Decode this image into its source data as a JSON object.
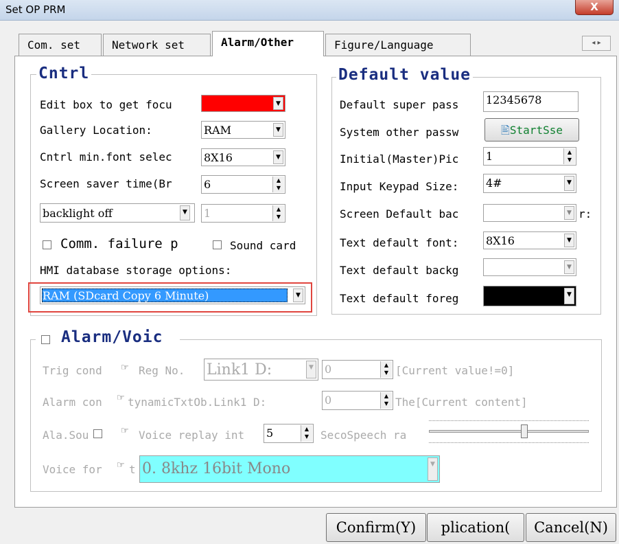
{
  "window": {
    "title": "Set OP PRM",
    "close_glyph": "X"
  },
  "tabs": [
    {
      "label": "Com. set"
    },
    {
      "label": "Network set"
    },
    {
      "label": "Alarm/Other",
      "active": true
    },
    {
      "label": "Figure/Language"
    }
  ],
  "cntrl": {
    "legend": "Cntrl",
    "edit_focus_label": "Edit box to get focu",
    "edit_focus_color": "#ff0000",
    "gallery_label": "Gallery Location:",
    "gallery_value": "RAM",
    "minfont_label": "Cntrl min.font selec",
    "minfont_value": "8X16",
    "saver_label": "Screen saver time(Br",
    "saver_value": "6",
    "backlight_value": "backlight off",
    "backlight_num": "1",
    "comm_failure_label": "Comm. failure p",
    "sound_card_label": "Sound card",
    "db_storage_label": "HMI database storage options:",
    "db_storage_value": "RAM (SDcard Copy 6 Minute)"
  },
  "defaults": {
    "legend": "Default value",
    "super_pass_label": "Default super pass",
    "super_pass_value": "12345678",
    "other_pass_label": "System other passw",
    "start_button": "StartSse",
    "initial_pic_label": "Initial(Master)Pic",
    "initial_pic_value": "1",
    "keypad_label": "Input Keypad Size:",
    "keypad_value": "4#",
    "screen_bg_label": "Screen Default bac",
    "screen_bg_suffix": "r:",
    "text_font_label": "Text default font:",
    "text_font_value": "8X16",
    "text_bg_label": "Text default backg",
    "text_fg_label": "Text default foreg",
    "text_fg_color": "#000000"
  },
  "alarm": {
    "legend": "Alarm/Voic",
    "trig_label": "Trig cond",
    "reg_no_label": "Reg No.",
    "link_value": "Link1 D:",
    "trig_num": "0",
    "trig_hint": "[Current value!=0]",
    "alarm_content_label": "Alarm con",
    "dynamic_label": "tynamicTxtOb.Link1 D:",
    "alarm_num": "0",
    "alarm_hint": "The[Current content]",
    "ala_sound_label": "Ala.Sou",
    "voice_replay_label": "Voice replay int",
    "voice_replay_value": "5",
    "speech_rate_label": "SecoSpeech ra",
    "slider_level": 0.6,
    "voice_format_label": "Voice for",
    "voice_format_suffix": "t",
    "voice_format_value": "0. 8khz  16bit Mono"
  },
  "buttons": {
    "confirm": "Confirm(Y)",
    "application": "plication(",
    "cancel": "Cancel(N)"
  }
}
